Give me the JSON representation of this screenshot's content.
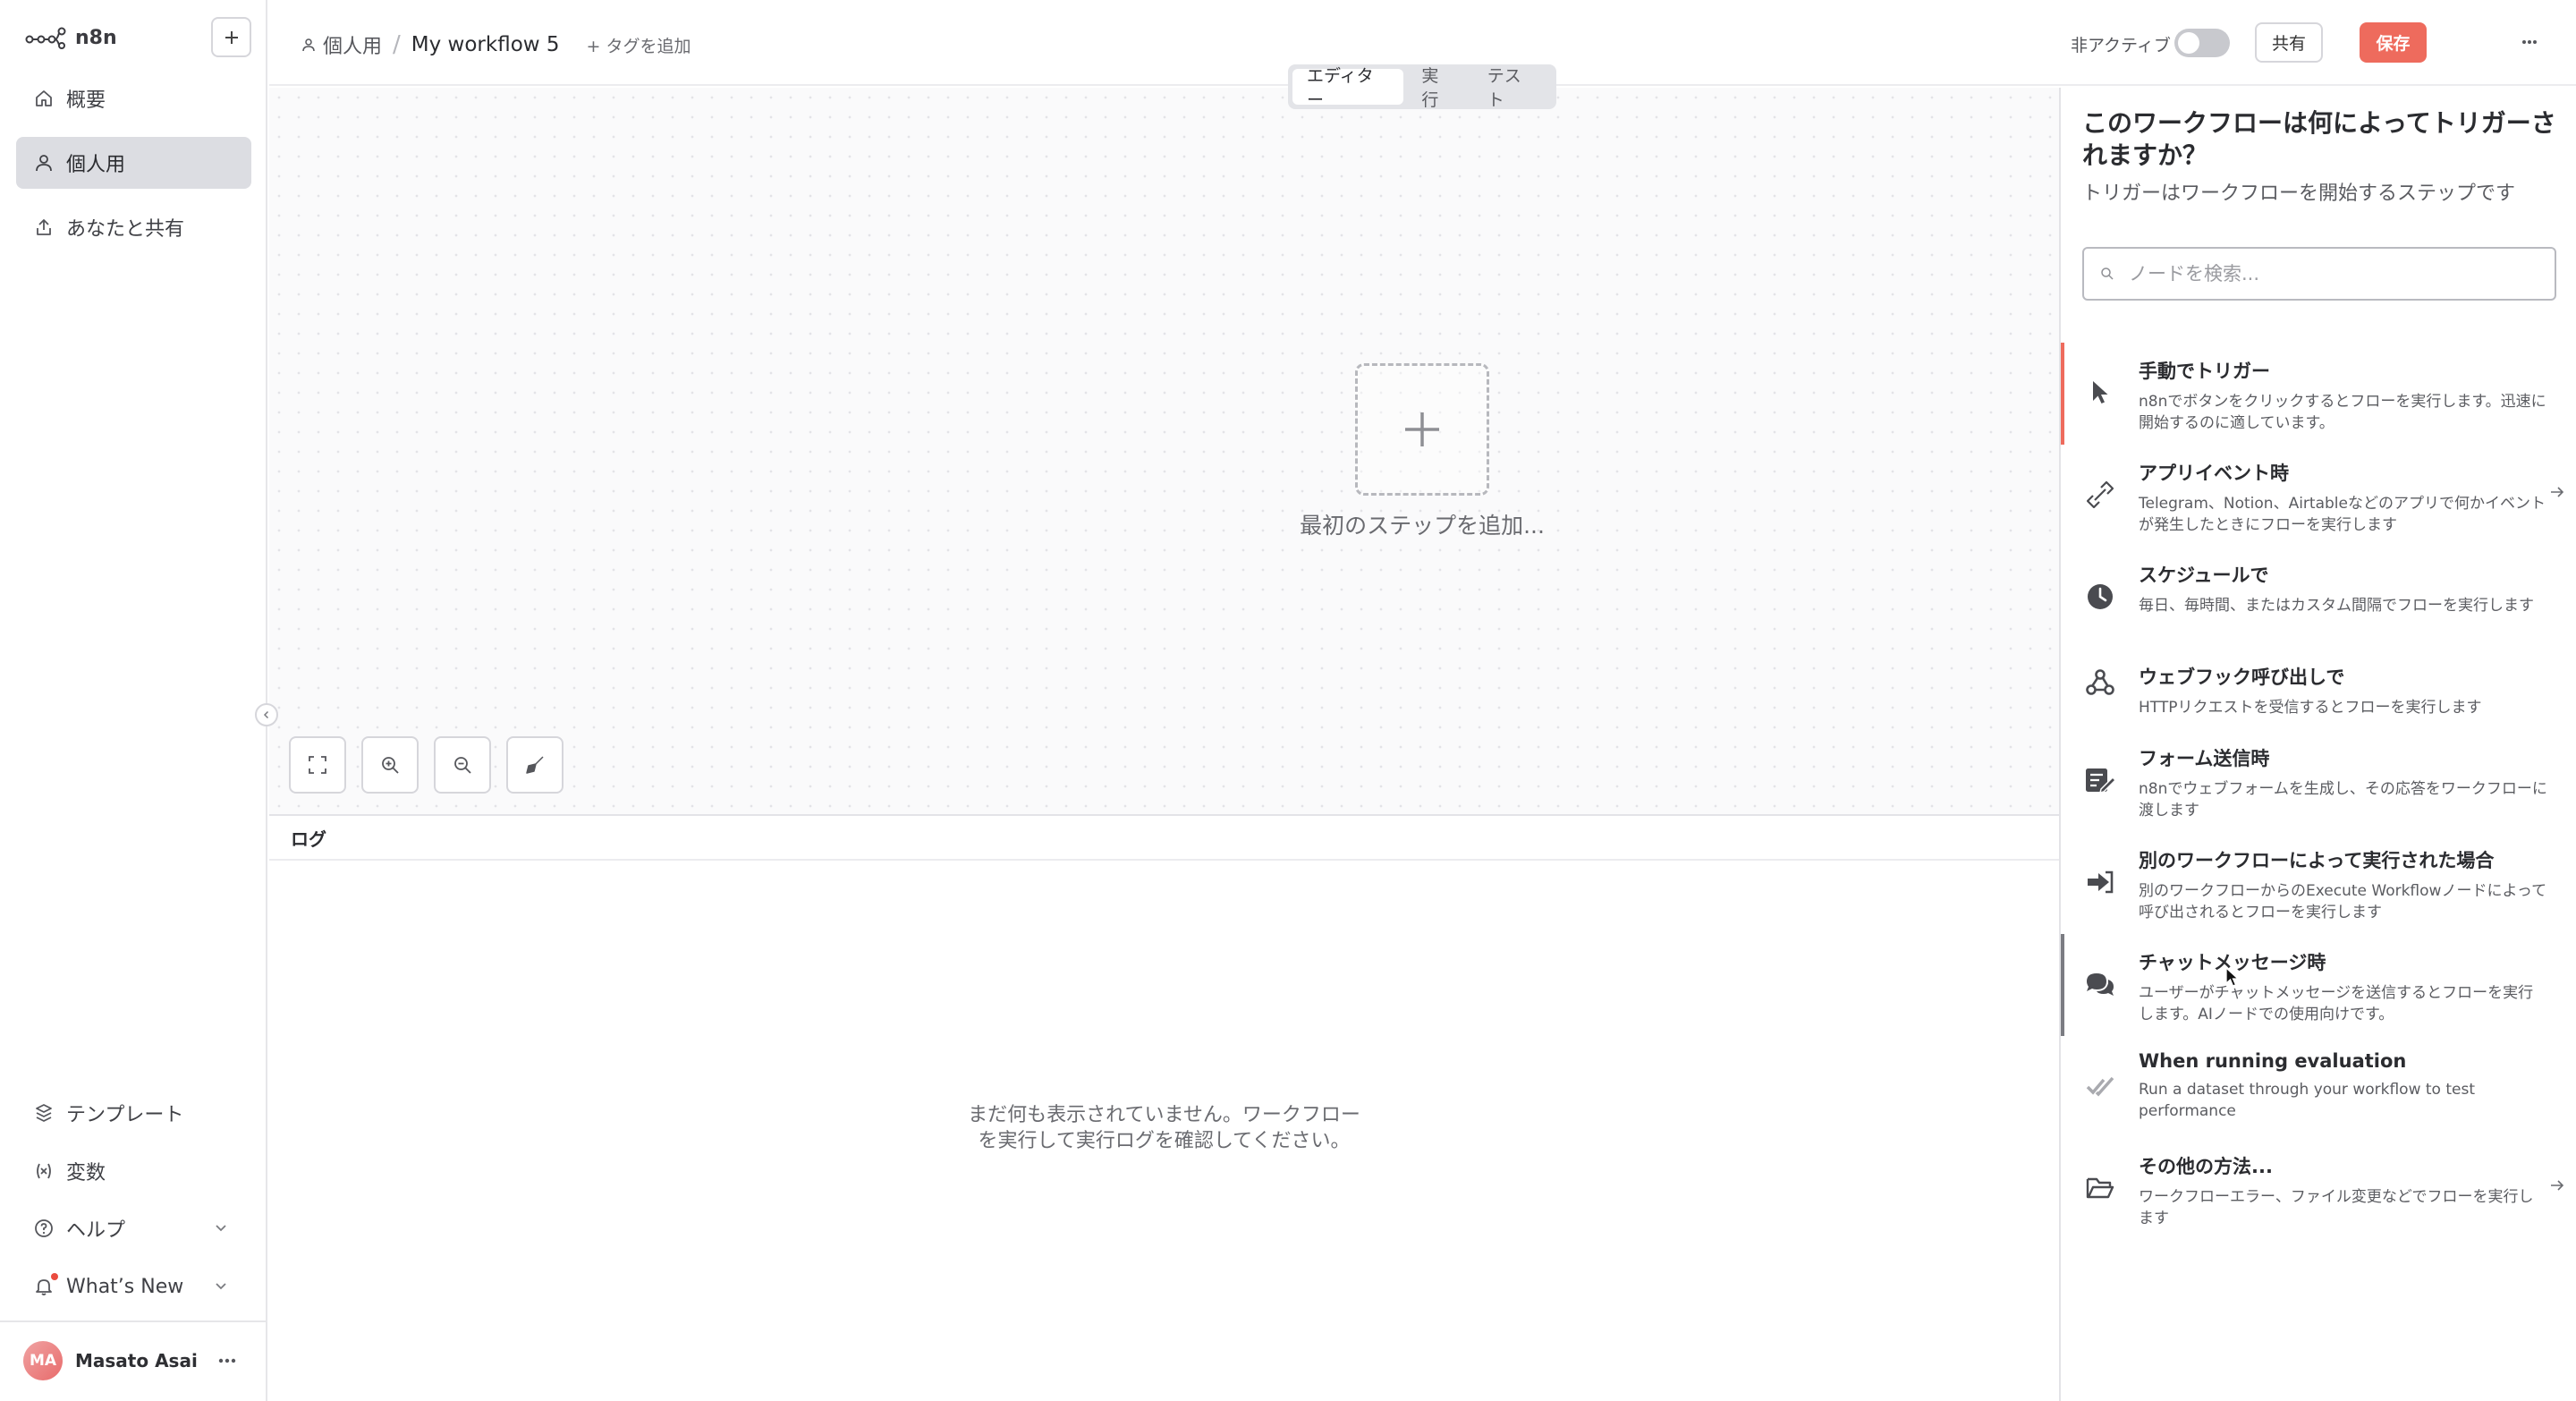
{
  "app": {
    "logo_text": "n8n"
  },
  "sidebar": {
    "items": [
      {
        "label": "概要",
        "icon": "home-icon",
        "active": false
      },
      {
        "label": "個人用",
        "icon": "user-icon",
        "active": true
      },
      {
        "label": "あなたと共有",
        "icon": "share-icon",
        "active": false
      }
    ],
    "bottom_items": [
      {
        "label": "テンプレート",
        "icon": "template-icon"
      },
      {
        "label": "変数",
        "icon": "variables-icon"
      },
      {
        "label": "ヘルプ",
        "icon": "help-icon"
      },
      {
        "label": "What’s New",
        "icon": "bell-icon"
      }
    ],
    "user": {
      "initials": "MA",
      "name": "Masato Asai"
    }
  },
  "header": {
    "owner": "個人用",
    "workflow_name": "My workflow 5",
    "add_tag": "+ タグを追加",
    "inactive_label": "非アクティブ",
    "share_label": "共有",
    "save_label": "保存",
    "accent_color": "#ee6b5d"
  },
  "canvas": {
    "tabs": [
      {
        "label": "エディター",
        "active": true
      },
      {
        "label": "実行",
        "active": false
      },
      {
        "label": "テスト",
        "active": false
      }
    ],
    "add_first_step": "最初のステップを追加..."
  },
  "logs": {
    "title": "ログ",
    "empty_line1": "まだ何も表示されていません。ワークフロー",
    "empty_line2": "を実行して実行ログを確認してください。"
  },
  "trigger_panel": {
    "title": "このワークフローは何によってトリガーされますか？",
    "subtitle": "トリガーはワークフローを開始するステップです",
    "search_placeholder": "ノードを検索...",
    "items": [
      {
        "title": "手動でトリガー",
        "desc": "n8nでボタンをクリックするとフローを実行します。迅速に開始するのに適しています。",
        "icon": "cursor-icon",
        "arrow": false
      },
      {
        "title": "アプリイベント時",
        "desc": "Telegram、Notion、Airtableなどのアプリで何かイベントが発生したときにフローを実行します",
        "icon": "app-event-icon",
        "arrow": true
      },
      {
        "title": "スケジュールで",
        "desc": "毎日、毎時間、またはカスタム間隔でフローを実行します",
        "icon": "clock-icon",
        "arrow": false
      },
      {
        "title": "ウェブフック呼び出しで",
        "desc": "HTTPリクエストを受信するとフローを実行します",
        "icon": "webhook-icon",
        "arrow": false
      },
      {
        "title": "フォーム送信時",
        "desc": "n8nでウェブフォームを生成し、その応答をワークフローに渡します",
        "icon": "form-icon",
        "arrow": false
      },
      {
        "title": "別のワークフローによって実行された場合",
        "desc": "別のワークフローからのExecute Workflowノードによって呼び出されるとフローを実行します",
        "icon": "sign-in-icon",
        "arrow": false
      },
      {
        "title": "チャットメッセージ時",
        "desc": "ユーザーがチャットメッセージを送信するとフローを実行します。AIノードでの使用向けです。",
        "icon": "chat-icon",
        "arrow": false
      },
      {
        "title": "When running evaluation",
        "desc": "Run a dataset through your workflow to test performance",
        "icon": "check-double-icon",
        "arrow": false
      },
      {
        "title": "その他の方法...",
        "desc": "ワークフローエラー、ファイル変更などでフローを実行します",
        "icon": "folder-icon",
        "arrow": true
      }
    ]
  }
}
